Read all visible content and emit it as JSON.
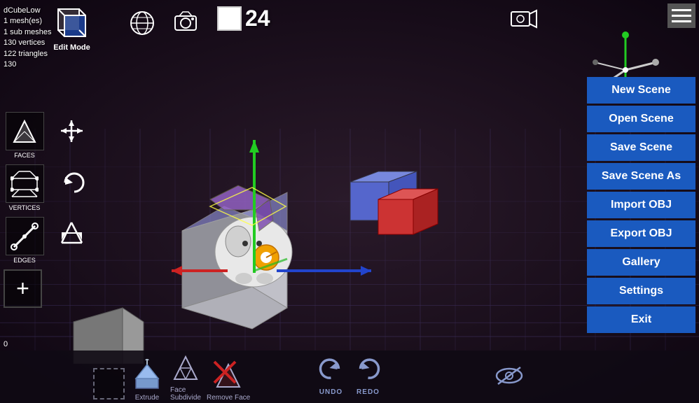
{
  "viewport": {
    "background": "#1a0a1a"
  },
  "top_left_info": {
    "line1": "dCubeLow",
    "line2": "1 mesh(es)",
    "line3": "1 sub meshes",
    "line4": "130 vertices",
    "line5": "122 triangles",
    "line6": "130"
  },
  "edit_mode": {
    "label": "Edit Mode"
  },
  "frame_counter": {
    "value": "24"
  },
  "right_menu": {
    "buttons": [
      {
        "label": "New Scene",
        "id": "new-scene"
      },
      {
        "label": "Open Scene",
        "id": "open-scene"
      },
      {
        "label": "Save Scene",
        "id": "save-scene"
      },
      {
        "label": "Save Scene As",
        "id": "save-scene-as"
      },
      {
        "label": "Import OBJ",
        "id": "import-obj"
      },
      {
        "label": "Export OBJ",
        "id": "export-obj"
      },
      {
        "label": "Gallery",
        "id": "gallery"
      },
      {
        "label": "Settings",
        "id": "settings"
      },
      {
        "label": "Exit",
        "id": "exit"
      }
    ]
  },
  "left_toolbar": {
    "tools": [
      {
        "label": "FACES",
        "id": "faces"
      },
      {
        "label": "VERTICES",
        "id": "vertices"
      },
      {
        "label": "EDGES",
        "id": "edges"
      }
    ]
  },
  "bottom_tools": {
    "items": [
      {
        "label": "Extrude",
        "id": "extrude"
      },
      {
        "label": "Face\nSubdivide",
        "id": "face-subdivide"
      },
      {
        "label": "Remove Face",
        "id": "remove-face"
      }
    ]
  },
  "undo_btn": {
    "label": "UNDO"
  },
  "redo_btn": {
    "label": "REDO"
  },
  "coordinate": {
    "value": "0"
  },
  "icons": {
    "globe": "🌐",
    "camera_photo": "📷",
    "video_camera": "🎥",
    "move": "✛",
    "rotate_undo": "↺",
    "scale": "⤡",
    "add": "+",
    "eye_hidden": "👁",
    "undo_arrow": "↩",
    "redo_arrow": "↪"
  }
}
